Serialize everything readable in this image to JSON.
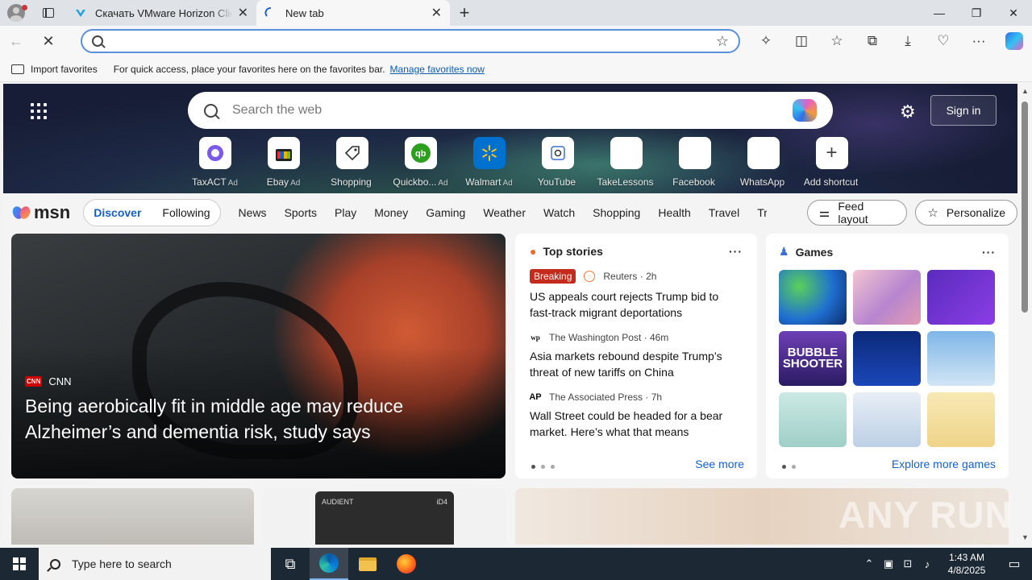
{
  "browser": {
    "tabs": [
      {
        "label": "Скачать VMware Horizon Client",
        "active": false
      },
      {
        "label": "New tab",
        "active": true
      }
    ],
    "address_value": "",
    "favorites_bar": {
      "import_label": "Import favorites",
      "message": "For quick access, place your favorites here on the favorites bar.",
      "link": "Manage favorites now"
    }
  },
  "newtab": {
    "search_placeholder": "Search the web",
    "sign_in": "Sign in",
    "shortcuts": [
      {
        "name": "TaxACT",
        "ad": "Ad",
        "icon": "taxact-icon"
      },
      {
        "name": "Ebay",
        "ad": "Ad",
        "icon": "ebay-icon"
      },
      {
        "name": "Shopping",
        "ad": "",
        "icon": "tag-icon"
      },
      {
        "name": "Quickbo...",
        "ad": "Ad",
        "icon": "quickbooks-icon"
      },
      {
        "name": "Walmart",
        "ad": "Ad",
        "icon": "walmart-icon"
      },
      {
        "name": "YouTube",
        "ad": "",
        "icon": "youtube-icon"
      },
      {
        "name": "TakeLessons",
        "ad": "",
        "icon": "takelessons-icon"
      },
      {
        "name": "Facebook",
        "ad": "",
        "icon": "facebook-icon"
      },
      {
        "name": "WhatsApp",
        "ad": "",
        "icon": "whatsapp-icon"
      },
      {
        "name": "Add shortcut",
        "ad": "",
        "icon": "plus-icon"
      }
    ]
  },
  "msn": {
    "logo": "msn",
    "segment": {
      "active": "Discover",
      "other": "Following"
    },
    "nav": [
      "News",
      "Sports",
      "Play",
      "Money",
      "Gaming",
      "Weather",
      "Watch",
      "Shopping",
      "Health",
      "Travel",
      "Tra"
    ],
    "feed_layout": "Feed layout",
    "personalize": "Personalize"
  },
  "main_story": {
    "source": "CNN",
    "headline": "Being aerobically fit in middle age may reduce Alzheimer’s and dementia risk, study says"
  },
  "top_stories": {
    "title": "Top stories",
    "items": [
      {
        "badge": "Breaking",
        "source": "Reuters",
        "age": "2h",
        "title": "US appeals court rejects Trump bid to fast-track migrant deportations"
      },
      {
        "badge": "",
        "source": "The Washington Post",
        "age": "46m",
        "title": "Asia markets rebound despite Trump’s threat of new tariffs on China"
      },
      {
        "badge": "",
        "source": "The Associated Press",
        "age": "7h",
        "title": "Wall Street could be headed for a bear market. Here’s what that means"
      }
    ],
    "see_more": "See more"
  },
  "games": {
    "title": "Games",
    "tile_label_bubble": "BUBBLE SHOOTER",
    "explore": "Explore more games"
  },
  "lower": {
    "device_label": "AUDIENT",
    "device_model": "iD4"
  },
  "watermark": "ANY RUN",
  "taskbar": {
    "search_placeholder": "Type here to search",
    "time": "1:43 AM",
    "date": "4/8/2025"
  }
}
